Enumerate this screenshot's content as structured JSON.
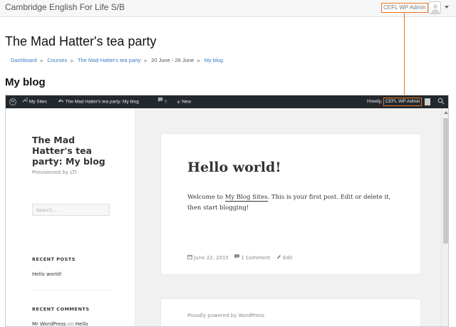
{
  "navbar": {
    "brand": "Cambridge English For Life S/B",
    "user_name": "CEFL WP Admin"
  },
  "page": {
    "title": "The Mad Hatter's tea party",
    "breadcrumb": [
      "Dashboard",
      "Courses",
      "The Mad Hatter's tea party",
      "20 June - 26 June",
      "My blog"
    ],
    "block_heading": "My blog"
  },
  "wp": {
    "adminbar": {
      "my_sites": "My Sites",
      "site_name": "The Mad Hatter's tea party: My blog",
      "comments_count": "0",
      "new_label": "New",
      "howdy": "Howdy,",
      "user_name": "CEFL WP Admin"
    },
    "sidebar": {
      "site_title": "The Mad Hatter's tea party: My blog",
      "site_description": "Provisioned by LTI",
      "search_placeholder": "Search …",
      "recent_posts_title": "RECENT POSTS",
      "recent_posts": [
        "Hello world!"
      ],
      "recent_comments_title": "RECENT COMMENTS",
      "recent_comment_author": "Mr WordPress",
      "recent_comment_on": "on",
      "recent_comment_post": "Hello world!"
    },
    "post": {
      "title": "Hello world!",
      "content_before": "Welcome to ",
      "content_link": "My Blog Sites",
      "content_after": ". This is your first post. Edit or delete it, then start blogging!",
      "date": "June 22, 2015",
      "comments": "1 Comment",
      "edit": "Edit"
    },
    "footer": "Proudly powered by WordPress"
  },
  "colors": {
    "highlight": "#e87722",
    "link": "#3a7cc1",
    "adminbar_bg": "#23282d"
  }
}
